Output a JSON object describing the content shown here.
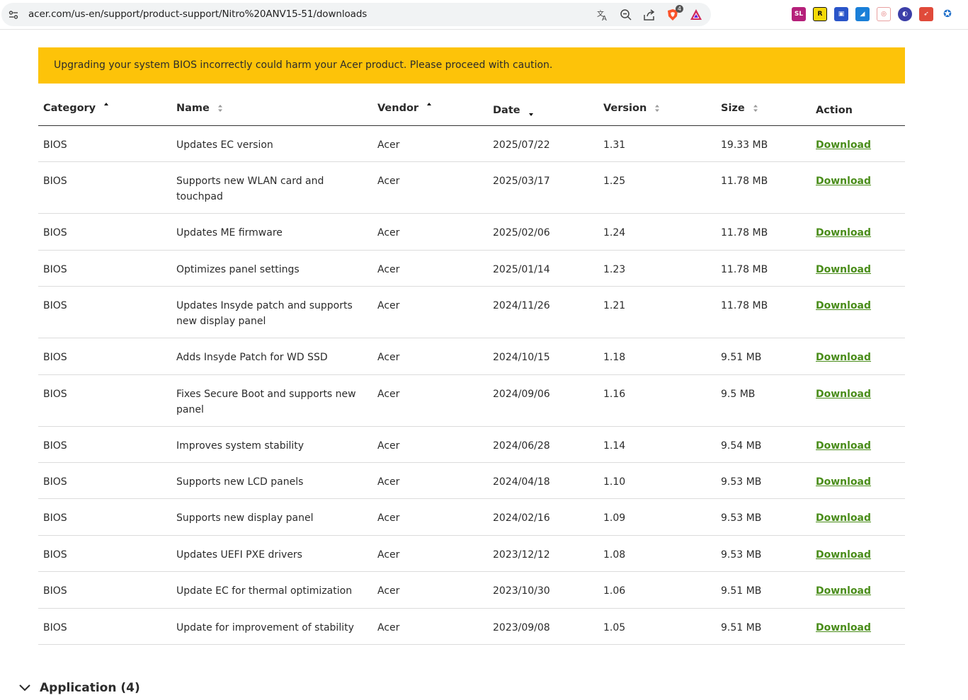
{
  "browser": {
    "url": "acer.com/us-en/support/product-support/Nitro%20ANV15-51/downloads",
    "brave_shield_count": "4"
  },
  "banner": {
    "text": "Upgrading your system BIOS incorrectly could harm your Acer product. Please proceed with caution.",
    "color": "#fdc309"
  },
  "table": {
    "headers": {
      "category": "Category",
      "name": "Name",
      "vendor": "Vendor",
      "date": "Date",
      "version": "Version",
      "size": "Size",
      "action": "Action"
    },
    "rows": [
      {
        "category": "BIOS",
        "name": "Updates EC version",
        "vendor": "Acer",
        "date": "2025/07/22",
        "version": "1.31",
        "size": "19.33 MB",
        "action": "Download"
      },
      {
        "category": "BIOS",
        "name": "Supports new WLAN card and touchpad",
        "vendor": "Acer",
        "date": "2025/03/17",
        "version": "1.25",
        "size": "11.78 MB",
        "action": "Download"
      },
      {
        "category": "BIOS",
        "name": "Updates ME firmware",
        "vendor": "Acer",
        "date": "2025/02/06",
        "version": "1.24",
        "size": "11.78 MB",
        "action": "Download"
      },
      {
        "category": "BIOS",
        "name": "Optimizes panel settings",
        "vendor": "Acer",
        "date": "2025/01/14",
        "version": "1.23",
        "size": "11.78 MB",
        "action": "Download"
      },
      {
        "category": "BIOS",
        "name": "Updates Insyde patch and supports new display panel",
        "vendor": "Acer",
        "date": "2024/11/26",
        "version": "1.21",
        "size": "11.78 MB",
        "action": "Download"
      },
      {
        "category": "BIOS",
        "name": "Adds Insyde Patch for WD SSD",
        "vendor": "Acer",
        "date": "2024/10/15",
        "version": "1.18",
        "size": "9.51 MB",
        "action": "Download"
      },
      {
        "category": "BIOS",
        "name": "Fixes Secure Boot and supports new panel",
        "vendor": "Acer",
        "date": "2024/09/06",
        "version": "1.16",
        "size": "9.5 MB",
        "action": "Download"
      },
      {
        "category": "BIOS",
        "name": "Improves system stability",
        "vendor": "Acer",
        "date": "2024/06/28",
        "version": "1.14",
        "size": "9.54 MB",
        "action": "Download"
      },
      {
        "category": "BIOS",
        "name": "Supports new LCD panels",
        "vendor": "Acer",
        "date": "2024/04/18",
        "version": "1.10",
        "size": "9.53 MB",
        "action": "Download"
      },
      {
        "category": "BIOS",
        "name": "Supports new display panel",
        "vendor": "Acer",
        "date": "2024/02/16",
        "version": "1.09",
        "size": "9.53 MB",
        "action": "Download"
      },
      {
        "category": "BIOS",
        "name": "Updates UEFI PXE drivers",
        "vendor": "Acer",
        "date": "2023/12/12",
        "version": "1.08",
        "size": "9.53 MB",
        "action": "Download"
      },
      {
        "category": "BIOS",
        "name": "Update EC for thermal optimization",
        "vendor": "Acer",
        "date": "2023/10/30",
        "version": "1.06",
        "size": "9.51 MB",
        "action": "Download"
      },
      {
        "category": "BIOS",
        "name": "Update for improvement of stability",
        "vendor": "Acer",
        "date": "2023/09/08",
        "version": "1.05",
        "size": "9.51 MB",
        "action": "Download"
      }
    ]
  },
  "section": {
    "title": "Application (4)"
  }
}
